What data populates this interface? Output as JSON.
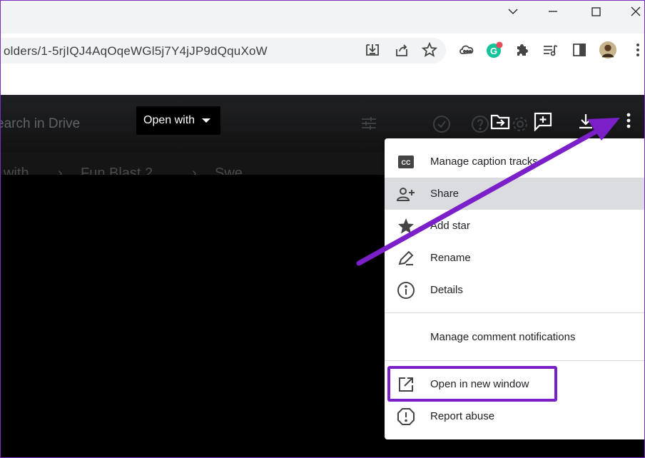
{
  "browser": {
    "url": "olders/1-5rjIQJ4AqOqeWGl5j7Y4jJP9dQquXoW",
    "window_controls": [
      "chevron-down-icon",
      "minimize-icon",
      "maximize-icon",
      "close-icon"
    ],
    "toolbar_icons": [
      "install-icon",
      "share-icon",
      "bookmark-star-icon",
      "extension-cloud-icon",
      "grammarly-icon",
      "puzzle-icon",
      "media-queue-icon",
      "side-panel-icon",
      "profile-avatar",
      "more-vert-icon"
    ]
  },
  "drive": {
    "search_placeholder": "earch in Drive",
    "open_with_label": "Open with",
    "breadcrumb_parts": [
      "with",
      "Fun Blast 2",
      "Swe"
    ]
  },
  "menu": {
    "items": [
      {
        "label": "Manage caption tracks",
        "icon": "cc-icon"
      },
      {
        "label": "Share",
        "icon": "person-add-icon"
      },
      {
        "label": "Add star",
        "icon": "star-icon"
      },
      {
        "label": "Rename",
        "icon": "pencil-icon"
      },
      {
        "label": "Details",
        "icon": "info-icon"
      },
      {
        "label": "Manage comment notifications",
        "icon": ""
      },
      {
        "label": "Open in new window",
        "icon": "open-in-new-icon"
      },
      {
        "label": "Report abuse",
        "icon": "report-icon"
      }
    ]
  },
  "annotation": {
    "color": "#7b1fc8"
  }
}
